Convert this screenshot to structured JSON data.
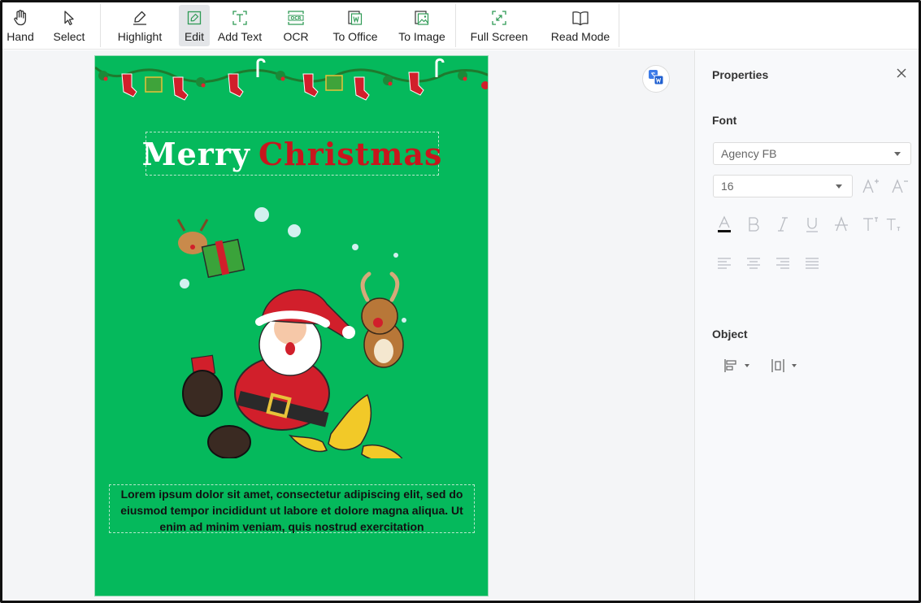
{
  "toolbar": {
    "hand": "Hand",
    "select": "Select",
    "highlight": "Highlight",
    "edit": "Edit",
    "add_text": "Add Text",
    "ocr": "OCR",
    "to_office": "To Office",
    "to_image": "To Image",
    "full_screen": "Full Screen",
    "read_mode": "Read Mode",
    "ocr_icon_text": "OCR"
  },
  "document": {
    "title_word1": "Merry",
    "title_word2": "Christmas",
    "body_text": "Lorem ipsum dolor sit amet, consectetur adipiscing elit, sed do eiusmod tempor incididunt ut labore et dolore magna aliqua. Ut enim ad minim veniam, quis nostrud exercitation",
    "page_color": "#05b95c"
  },
  "properties": {
    "title": "Properties",
    "font_section": "Font",
    "font_family": "Agency FB",
    "font_size": "16",
    "object_section": "Object"
  },
  "colors": {
    "accent_red": "#c8161d",
    "page_green": "#05b95c",
    "icon_gray": "#b9bcc2"
  }
}
